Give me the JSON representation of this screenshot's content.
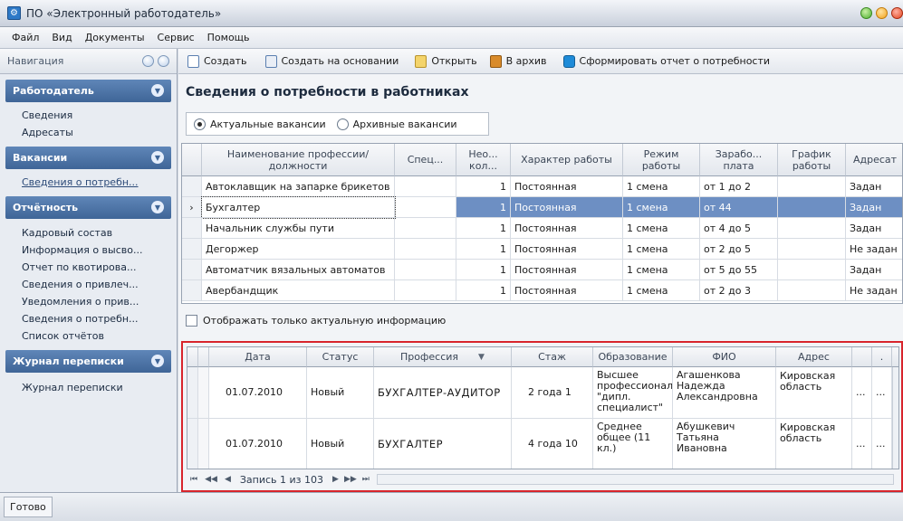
{
  "window": {
    "title": "ПО «Электронный работодатель»"
  },
  "menu": [
    "Файл",
    "Вид",
    "Документы",
    "Сервис",
    "Помощь"
  ],
  "nav": {
    "header": "Навигация",
    "groups": [
      {
        "title": "Работодатель",
        "items": [
          "Сведения",
          "Адресаты"
        ]
      },
      {
        "title": "Вакансии",
        "items": [
          "Сведения о потребн..."
        ]
      },
      {
        "title": "Отчётность",
        "items": [
          "Кадровый состав",
          "Информация о высво...",
          "Отчет по квотирова...",
          "Сведения о привлеч...",
          "Уведомления о прив...",
          "Сведения о потребн...",
          "Список отчётов"
        ]
      },
      {
        "title": "Журнал переписки",
        "items": [
          "Журнал переписки"
        ]
      }
    ]
  },
  "toolbar": {
    "create": "Создать",
    "create_based": "Создать на основании",
    "open": "Открыть",
    "archive": "В архив",
    "report": "Сформировать отчет о потребности"
  },
  "page_title": "Сведения о потребности в работниках",
  "radio": {
    "actual": "Актуальные вакансии",
    "archived": "Архивные вакансии"
  },
  "grid1": {
    "headers": [
      "Наименование профессии/должности",
      "Спец...",
      "Нео... кол...",
      "Характер работы",
      "Режим работы",
      "Зарабо... плата",
      "График работы",
      "Адресат"
    ],
    "rows": [
      [
        "Автоклавщик на запарке брикетов",
        "",
        "1",
        "Постоянная",
        "1 смена",
        "от 1 до 2",
        "",
        "Задан"
      ],
      [
        "Бухгалтер",
        "",
        "1",
        "Постоянная",
        "1 смена",
        "от 44",
        "",
        "Задан"
      ],
      [
        "Начальник службы пути",
        "",
        "1",
        "Постоянная",
        "1 смена",
        "от 4 до 5",
        "",
        "Задан"
      ],
      [
        "Дегоржер",
        "",
        "1",
        "Постоянная",
        "1 смена",
        "от 2 до 5",
        "",
        "Не задан"
      ],
      [
        "Автоматчик вязальных автоматов",
        "",
        "1",
        "Постоянная",
        "1 смена",
        "от 5 до 55",
        "",
        "Задан"
      ],
      [
        "Авербандщик",
        "",
        "1",
        "Постоянная",
        "1 смена",
        "от 2 до 3",
        "",
        "Не задан"
      ]
    ],
    "selected_row": 1
  },
  "only_actual_label": "Отображать только актуальную информацию",
  "grid2": {
    "headers": [
      "Дата",
      "Статус",
      "Профессия",
      "Стаж",
      "Образование",
      "ФИО",
      "Адрес",
      "",
      "."
    ],
    "rows": [
      {
        "date": "01.07.2010",
        "status": "Новый",
        "profession": "БУХГАЛТЕР-АУДИТОР",
        "experience": "2 года 1",
        "education": "Высшее профессиональное, \"дипл. специалист\"",
        "fio": "Агашенкова Надежда Александровна",
        "address": "Кировская область",
        "a": "...",
        "b": "..."
      },
      {
        "date": "01.07.2010",
        "status": "Новый",
        "profession": "БУХГАЛТЕР",
        "experience": "4 года 10",
        "education": "Среднее общее (11 кл.)",
        "fio": "Абушкевич Татьяна Ивановна",
        "address": "Кировская область",
        "a": "...",
        "b": "..."
      }
    ],
    "pager": "Запись 1 из 103"
  },
  "status": "Готово",
  "colors": {
    "accent": "#4a72a8",
    "selection": "#6d8fc3",
    "highlight_frame": "#d8252c"
  }
}
